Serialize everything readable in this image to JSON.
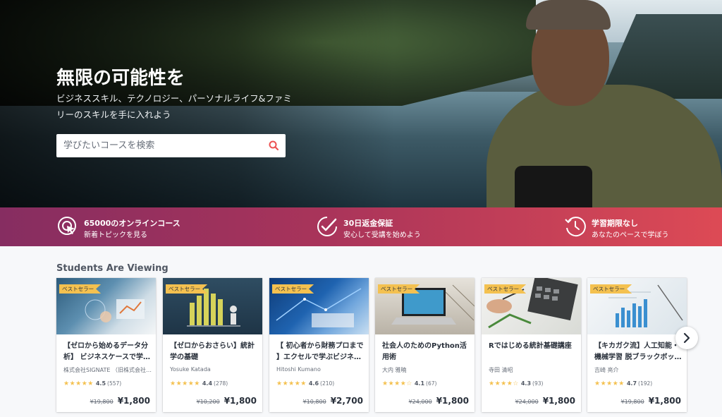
{
  "hero": {
    "title": "無限の可能性を",
    "subtitle": "ビジネススキル、テクノロジー、パーソナルライフ&ファミリーのスキルを手に入れよう",
    "search_placeholder": "学びたいコースを検索"
  },
  "features": [
    {
      "title": "65000のオンラインコース",
      "subtitle": "新着トピックを見る",
      "icon": "cursor-click-icon"
    },
    {
      "title": "30日返金保証",
      "subtitle": "安心して受講を始めよう",
      "icon": "checkmark-badge-icon"
    },
    {
      "title": "学習期限なし",
      "subtitle": "あなたのペースで学ぼう",
      "icon": "clock-history-icon"
    }
  ],
  "section": {
    "title": "Students Are Viewing"
  },
  "badge_label": "ベストセラー",
  "courses": [
    {
      "title": "【ゼロから始めるデータ分析】 ビジネスケースで学…",
      "author": "株式会社SIGNATE （旧株式会社…",
      "stars": "★★★★★",
      "rating": "4.5",
      "count": "(557)",
      "old_price": "¥19,800",
      "price": "¥1,800"
    },
    {
      "title": "【ゼロからおさらい】統計学の基礎",
      "author": "Yosuke Katada",
      "stars": "★★★★★",
      "rating": "4.4",
      "count": "(278)",
      "old_price": "¥10,200",
      "price": "¥1,800"
    },
    {
      "title": "【 初心者から財務プロまで 】エクセルで学ぶビジネ…",
      "author": "Hitoshi Kumano",
      "stars": "★★★★★",
      "rating": "4.6",
      "count": "(210)",
      "old_price": "¥10,800",
      "price": "¥2,700"
    },
    {
      "title": "社会人のためのPython活用術",
      "author": "大内 雅曉",
      "stars": "★★★★☆",
      "rating": "4.1",
      "count": "(67)",
      "old_price": "¥24,000",
      "price": "¥1,800"
    },
    {
      "title": "Rではじめる統計基礎講座",
      "author": "寺田 清昭",
      "stars": "★★★★☆",
      "rating": "4.3",
      "count": "(93)",
      "old_price": "¥24,000",
      "price": "¥1,800"
    },
    {
      "title": "【キカガク流】人工知能・機械学習 脱ブラックボッ…",
      "author": "吉崎 亮介",
      "stars": "★★★★★",
      "rating": "4.7",
      "count": "(192)",
      "old_price": "¥19,800",
      "price": "¥1,800"
    }
  ],
  "colors": {
    "accent": "#ec5252",
    "banner_start": "#862d61",
    "banner_end": "#dd4a55",
    "badge": "#f4c150"
  }
}
